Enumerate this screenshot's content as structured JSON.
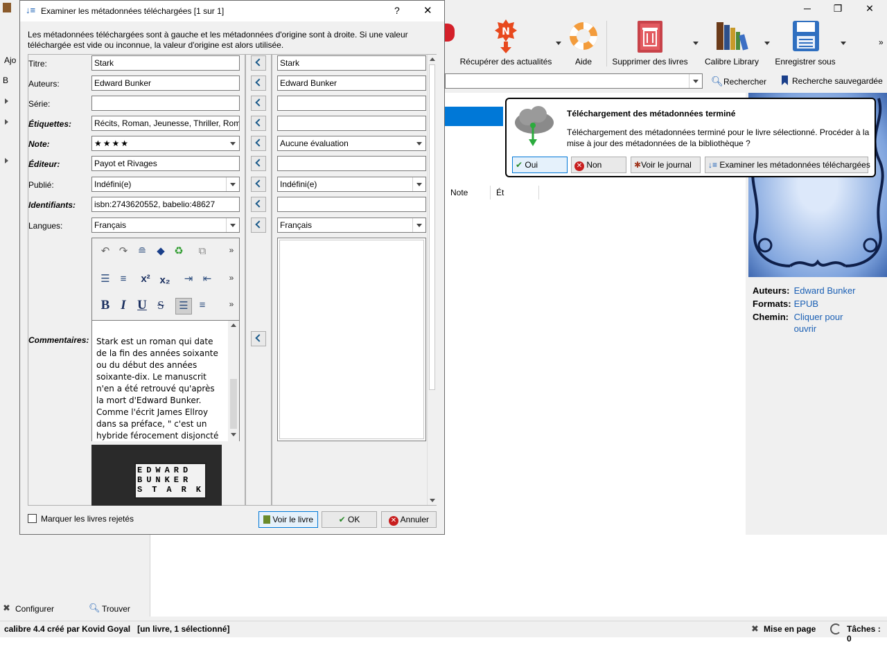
{
  "main": {
    "toolbar": {
      "items": [
        {
          "label": "Récupérer des actualités",
          "icon": "news-icon"
        },
        {
          "label": "Aide",
          "icon": "lifebuoy-icon"
        },
        {
          "label": "Supprimer des livres",
          "icon": "trash-icon"
        },
        {
          "label": "Calibre Library",
          "icon": "library-icon"
        },
        {
          "label": "Enregistrer sous",
          "icon": "save-icon"
        }
      ],
      "left_fragment": "Ajo",
      "overflow": "»"
    },
    "search": {
      "search_label": "Rechercher",
      "saved_search_label": "Recherche sauvegardée",
      "left_fragment": "B"
    },
    "columns": [
      "Note",
      "Ét"
    ],
    "details": {
      "authors_key": "Auteurs:",
      "authors_value": "Edward Bunker",
      "formats_key": "Formats:",
      "formats_value": "EPUB",
      "path_key": "Chemin:",
      "path_value_line1": "Cliquer pour",
      "path_value_line2": "ouvrir"
    },
    "left_panel": {
      "configure_label": "Configurer",
      "find_label": "Trouver"
    },
    "statusbar": {
      "left_text": "calibre 4.4 créé par Kovid Goyal   [un livre, 1 sélectionné]",
      "layout_label": "Mise en page",
      "jobs_label": "Tâches : 0"
    }
  },
  "popup": {
    "title": "Téléchargement des métadonnées terminé",
    "message": "Téléchargement des métadonnées terminé pour le livre sélectionné. Procéder à la mise à jour des métadonnées de la bibliothèque ?",
    "buttons": {
      "yes": "Oui",
      "no": "Non",
      "log": "Voir le journal",
      "review": "Examiner les métadonnées téléchargées"
    }
  },
  "dialog": {
    "title": "Examiner les métadonnées téléchargées [1 sur 1]",
    "help": "?",
    "close": "✕",
    "intro": "Les métadonnées téléchargées sont à gauche et les métadonnées d'origine sont à droite. Si une valeur téléchargée est vide ou inconnue, la valeur d'origine est alors utilisée.",
    "labels": {
      "title": "Titre:",
      "authors": "Auteurs:",
      "series": "Série:",
      "tags": "Étiquettes:",
      "rating": "Note:",
      "publisher": "Éditeur:",
      "published": "Publié:",
      "identifiers": "Identifiants:",
      "languages": "Langues:",
      "comments": "Commentaires:"
    },
    "downloaded": {
      "title": "Stark",
      "authors": "Edward Bunker",
      "series": "",
      "tags": "Récits, Roman, Jeunesse, Thriller, Roman",
      "rating": "★★★★",
      "publisher": "Payot et Rivages",
      "published": "Indéfini(e)",
      "identifiers": "isbn:2743620552, babelio:48627",
      "languages": "Français",
      "comments": "Stark est un roman qui date de la fin des années soixante ou du début des années soixante-dix. Le manuscrit n'en a été retrouvé qu'après la mort d'Edward Bunker. Comme l'écrit James Ellroy dans sa préface, \" c'est un hybride férocement disjoncté de roman pulp noir",
      "cover_lines": [
        "EDWARD",
        "BUNKER",
        "STARK"
      ]
    },
    "original": {
      "title": "Stark",
      "authors": "Edward Bunker",
      "series": "",
      "tags": "",
      "rating": "Aucune évaluation",
      "publisher": "",
      "published": "Indéfini(e)",
      "identifiers": "",
      "languages": "Français"
    },
    "editor_more": "»",
    "footer": {
      "mark_rejected": "Marquer les livres rejetés",
      "view_book": "Voir le livre",
      "ok": "OK",
      "cancel": "Annuler"
    }
  },
  "colors": {
    "accent": "#0078d7",
    "link": "#1a5fb4",
    "selection": "#0078d7",
    "cover_blue": "#5a84c8"
  }
}
